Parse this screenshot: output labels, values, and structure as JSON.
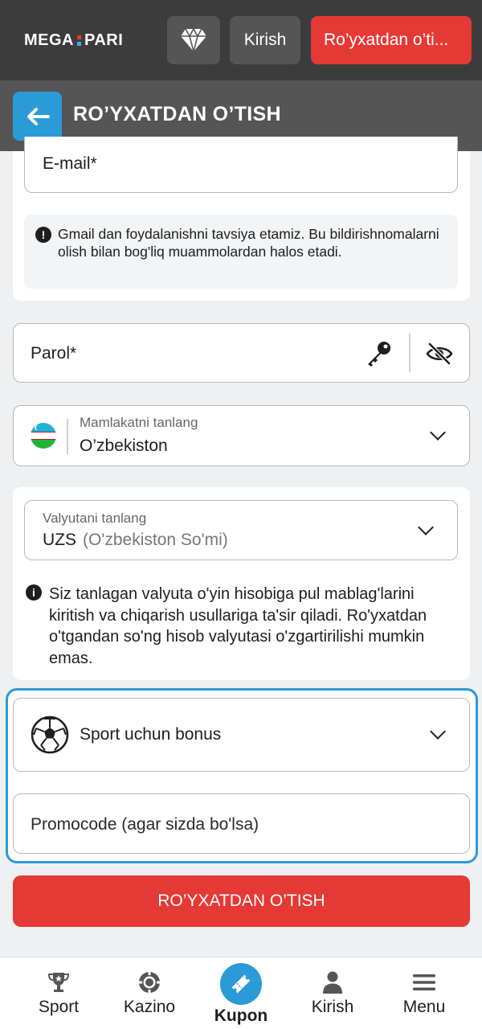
{
  "header": {
    "logo_left": "MEGA",
    "logo_right": "PARI",
    "login_label": "Kirish",
    "register_label": "Ro’yxatdan o’ti..."
  },
  "page": {
    "title": "RO’YXATDAN O’TISH"
  },
  "form": {
    "email_label": "E-mail*",
    "email_notice": "Gmail dan foydalanishni tavsiya etamiz. Bu bildirishnomalarni olish bilan bog'liq muammolardan halos etadi.",
    "password_label": "Parol*",
    "country_label": "Mamlakatni tanlang",
    "country_value": "O’zbekiston",
    "currency_label": "Valyutani tanlang",
    "currency_code": "UZS",
    "currency_name": "(O'zbekiston So'mi)",
    "currency_notice": "Siz tanlagan valyuta o'yin hisobiga pul mablag'larini kiritish va chiqarish usullariga ta'sir qiladi. Ro'yxatdan o'tgandan so'ng hisob valyutasi o'zgartirilishi mumkin emas.",
    "bonus_value": "Sport uchun bonus",
    "promocode_placeholder": "Promocode (agar sizda bo'lsa)",
    "submit_label": "RO’YXATDAN O’TISH"
  },
  "bottom_nav": {
    "sport": "Sport",
    "kazino": "Kazino",
    "kupon": "Kupon",
    "kirish": "Kirish",
    "menu": "Menu"
  },
  "colors": {
    "accent_red": "#e53935",
    "accent_blue": "#2b9bd8",
    "header_dark": "#3c3c3c",
    "header_mid": "#555555"
  }
}
